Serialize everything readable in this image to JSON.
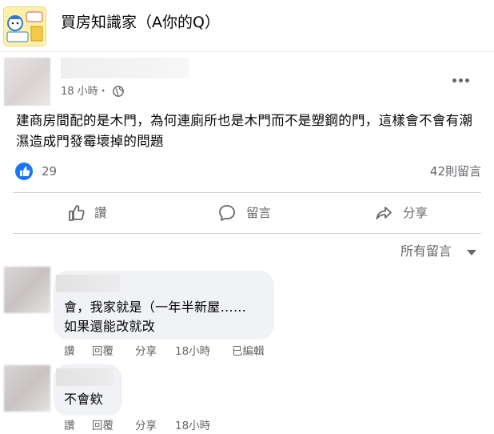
{
  "group": {
    "name": "買房知識家（A你的Q）"
  },
  "post": {
    "time": "18 小時・",
    "body": "建商房間配的是木門，為何連廁所也是木門而不是塑鋼的門，這樣會不會有潮濕造成門發霉壞掉的問題",
    "likes": "29",
    "comments_count": "42則留言"
  },
  "actions": {
    "like": "讚",
    "comment": "留言",
    "share": "分享"
  },
  "sort": {
    "label": "所有留言"
  },
  "comments": [
    {
      "lines": [
        "會，我家就是（一年半新屋……",
        "如果還能改就改"
      ],
      "like": "讚",
      "reply": "回覆",
      "share": "分享",
      "time": "18小時",
      "edited": "已編輯"
    },
    {
      "lines": [
        "不會欸"
      ],
      "like": "讚",
      "reply": "回覆",
      "share": "分享",
      "time": "18小時"
    }
  ],
  "colors": {
    "brand_blue": "#1877f2",
    "secondary_text": "#65676b",
    "bubble": "#f0f2f5"
  }
}
